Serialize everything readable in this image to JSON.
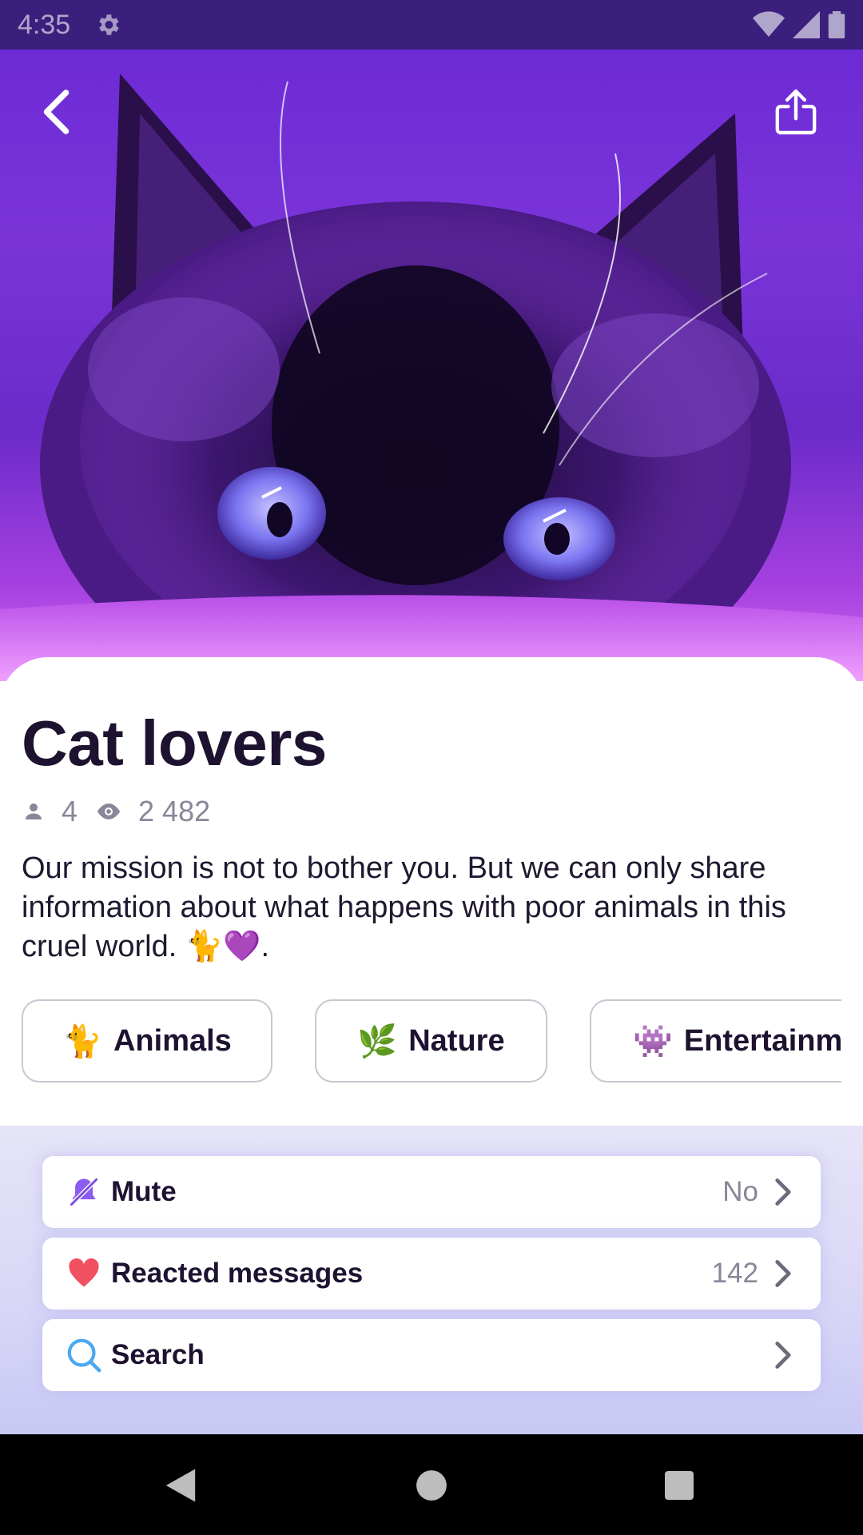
{
  "status_bar": {
    "time": "4:35",
    "icons": [
      "gear-icon",
      "wifi-icon",
      "signal-icon",
      "battery-icon"
    ]
  },
  "hero": {
    "image": "purple-tinted-cat-photo",
    "back_icon": "chevron-left-icon",
    "share_icon": "share-icon"
  },
  "channel": {
    "title": "Cat lovers",
    "members": "4",
    "views": "2 482",
    "description": "Our mission is not to bother you. But we can only share information about what happens with poor animals in this cruel world. 🐈💜."
  },
  "tags": [
    {
      "emoji": "🐈",
      "label": "Animals"
    },
    {
      "emoji": "🌿",
      "label": "Nature"
    },
    {
      "emoji": "👾",
      "label": "Entertainment"
    }
  ],
  "settings": [
    {
      "icon": "muted-bell-icon",
      "label": "Mute",
      "value": "No"
    },
    {
      "icon": "heart-icon",
      "label": "Reacted messages",
      "value": "142"
    },
    {
      "icon": "search-icon",
      "label": "Search",
      "value": ""
    }
  ],
  "colors": {
    "status_bar": "#3b1f7d",
    "hero_purple": "#6d2bd6",
    "title_text": "#1d1230",
    "muted_text": "#8a8598",
    "section_bg": "#dcdaf7",
    "mute_icon": "#8a5cf0",
    "heart_icon": "#f05060",
    "search_icon": "#4aa8f0"
  }
}
